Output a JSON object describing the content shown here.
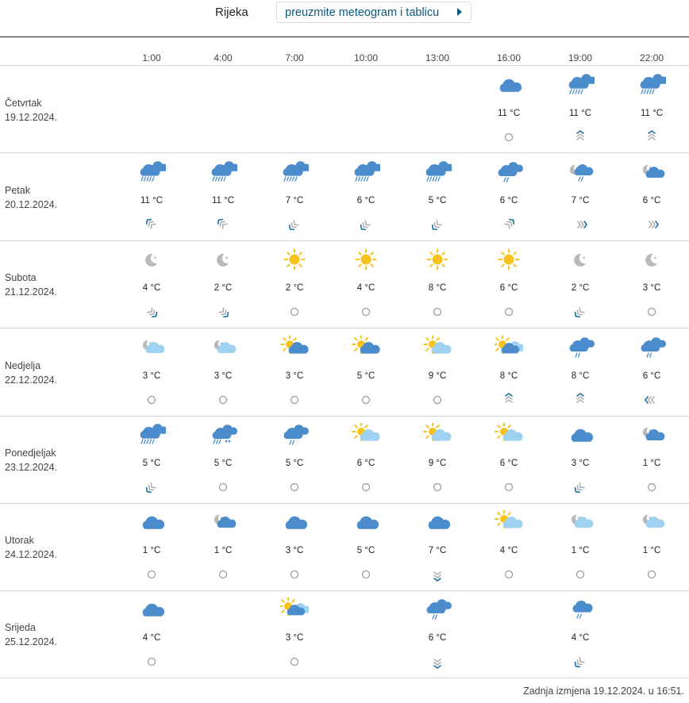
{
  "header": {
    "city": "Rijeka",
    "meteogram_button_label": "preuzmite meteogram i tablicu"
  },
  "hours": [
    "1:00",
    "4:00",
    "7:00",
    "10:00",
    "13:00",
    "16:00",
    "19:00",
    "22:00"
  ],
  "days": [
    {
      "name": "Četvrtak",
      "date": "19.12.2024.",
      "cells": [
        null,
        null,
        null,
        null,
        null,
        {
          "icon": "cloudy-icon",
          "temp": "11 °C",
          "wind": "calm-icon"
        },
        {
          "icon": "cloudy-heavy-rain-icon",
          "temp": "11 °C",
          "wind": "wind-strong-north-icon"
        },
        {
          "icon": "cloudy-heavy-rain-icon",
          "temp": "11 °C",
          "wind": "wind-strong-north-icon"
        }
      ]
    },
    {
      "name": "Petak",
      "date": "20.12.2024.",
      "cells": [
        {
          "icon": "cloudy-heavy-rain-icon",
          "temp": "11 °C",
          "wind": "wind-southeast-icon"
        },
        {
          "icon": "cloudy-heavy-rain-icon",
          "temp": "11 °C",
          "wind": "wind-southeast-icon"
        },
        {
          "icon": "cloudy-heavy-rain-icon",
          "temp": "7 °C",
          "wind": "wind-northeast-icon"
        },
        {
          "icon": "cloudy-heavy-rain-icon",
          "temp": "6 °C",
          "wind": "wind-strong-northeast-icon"
        },
        {
          "icon": "cloudy-heavy-rain-icon",
          "temp": "5 °C",
          "wind": "wind-strong-northeast-icon"
        },
        {
          "icon": "cloudy-rain-icon",
          "temp": "6 °C",
          "wind": "wind-southwest-icon"
        },
        {
          "icon": "night-cloudy-rain-icon",
          "temp": "7 °C",
          "wind": "wind-west-icon"
        },
        {
          "icon": "night-cloudy-icon",
          "temp": "6 °C",
          "wind": "wind-west-icon"
        }
      ]
    },
    {
      "name": "Subota",
      "date": "21.12.2024.",
      "cells": [
        {
          "icon": "clear-night-icon",
          "temp": "4 °C",
          "wind": "wind-northwest-icon"
        },
        {
          "icon": "clear-night-icon",
          "temp": "2 °C",
          "wind": "wind-northwest-icon"
        },
        {
          "icon": "sun-icon",
          "temp": "2 °C",
          "wind": "calm-icon"
        },
        {
          "icon": "sun-icon",
          "temp": "4 °C",
          "wind": "calm-icon"
        },
        {
          "icon": "sun-icon",
          "temp": "8 °C",
          "wind": "calm-icon"
        },
        {
          "icon": "sun-icon",
          "temp": "6 °C",
          "wind": "calm-icon"
        },
        {
          "icon": "clear-night-icon",
          "temp": "2 °C",
          "wind": "wind-northeast-light-icon"
        },
        {
          "icon": "clear-night-icon",
          "temp": "3 °C",
          "wind": "calm-icon"
        }
      ]
    },
    {
      "name": "Nedjelja",
      "date": "22.12.2024.",
      "cells": [
        {
          "icon": "night-partly-cloudy-icon",
          "temp": "3 °C",
          "wind": "calm-icon"
        },
        {
          "icon": "night-partly-cloudy-icon",
          "temp": "3 °C",
          "wind": "calm-icon"
        },
        {
          "icon": "sun-cloudy-icon",
          "temp": "3 °C",
          "wind": "calm-icon"
        },
        {
          "icon": "sun-cloudy-icon",
          "temp": "5 °C",
          "wind": "calm-icon"
        },
        {
          "icon": "partly-cloudy-icon",
          "temp": "9 °C",
          "wind": "calm-icon"
        },
        {
          "icon": "sun-double-cloud-icon",
          "temp": "8 °C",
          "wind": "wind-strong-north-icon"
        },
        {
          "icon": "cloudy-rain-icon",
          "temp": "8 °C",
          "wind": "wind-strong-north-icon"
        },
        {
          "icon": "cloudy-rain-icon",
          "temp": "6 °C",
          "wind": "wind-east-icon"
        }
      ]
    },
    {
      "name": "Ponedjeljak",
      "date": "23.12.2024.",
      "cells": [
        {
          "icon": "cloudy-heavy-rain-icon",
          "temp": "5 °C",
          "wind": "wind-northeast-icon"
        },
        {
          "icon": "cloudy-sleet-icon",
          "temp": "5 °C",
          "wind": "calm-icon"
        },
        {
          "icon": "cloudy-rain-icon",
          "temp": "5 °C",
          "wind": "calm-icon"
        },
        {
          "icon": "partly-cloudy-icon",
          "temp": "6 °C",
          "wind": "calm-icon"
        },
        {
          "icon": "partly-cloudy-icon",
          "temp": "9 °C",
          "wind": "calm-icon"
        },
        {
          "icon": "partly-cloudy-icon",
          "temp": "6 °C",
          "wind": "calm-icon"
        },
        {
          "icon": "cloudy-icon",
          "temp": "3 °C",
          "wind": "wind-northeast-light-icon"
        },
        {
          "icon": "night-cloudy-icon",
          "temp": "1 °C",
          "wind": "calm-icon"
        }
      ]
    },
    {
      "name": "Utorak",
      "date": "24.12.2024.",
      "cells": [
        {
          "icon": "cloudy-icon",
          "temp": "1 °C",
          "wind": "calm-icon"
        },
        {
          "icon": "night-cloudy-icon",
          "temp": "1 °C",
          "wind": "calm-icon"
        },
        {
          "icon": "cloudy-icon",
          "temp": "3 °C",
          "wind": "calm-icon"
        },
        {
          "icon": "cloudy-icon",
          "temp": "5 °C",
          "wind": "calm-icon"
        },
        {
          "icon": "cloudy-icon",
          "temp": "7 °C",
          "wind": "wind-strong-south-icon"
        },
        {
          "icon": "partly-cloudy-icon",
          "temp": "4 °C",
          "wind": "calm-icon"
        },
        {
          "icon": "night-partly-cloudy-icon",
          "temp": "1 °C",
          "wind": "calm-icon"
        },
        {
          "icon": "night-partly-cloudy-icon",
          "temp": "1 °C",
          "wind": "calm-icon"
        }
      ]
    },
    {
      "name": "Srijeda",
      "date": "25.12.2024.",
      "cells": [
        {
          "icon": "cloudy-icon",
          "temp": "4 °C",
          "wind": "calm-icon"
        },
        null,
        {
          "icon": "sun-double-cloud-icon",
          "temp": "3 °C",
          "wind": "calm-icon"
        },
        null,
        {
          "icon": "cloudy-rain-icon",
          "temp": "6 °C",
          "wind": "wind-strong-south-icon"
        },
        null,
        {
          "icon": "cloudy-light-rain-icon",
          "temp": "4 °C",
          "wind": "wind-northeast-light-icon"
        },
        null
      ]
    }
  ],
  "footer": {
    "last_modified": "Zadnja izmjena 19.12.2024. u 16:51."
  },
  "colors": {
    "cloud_dark": "#4a8ccc",
    "cloud_light": "#9fd2f0",
    "cloud_grey": "#b9b9b9",
    "sun": "#f7c21a",
    "wind_blue": "#1b6f9e",
    "wind_grey": "#b0b0b0",
    "link": "#0a5780"
  }
}
